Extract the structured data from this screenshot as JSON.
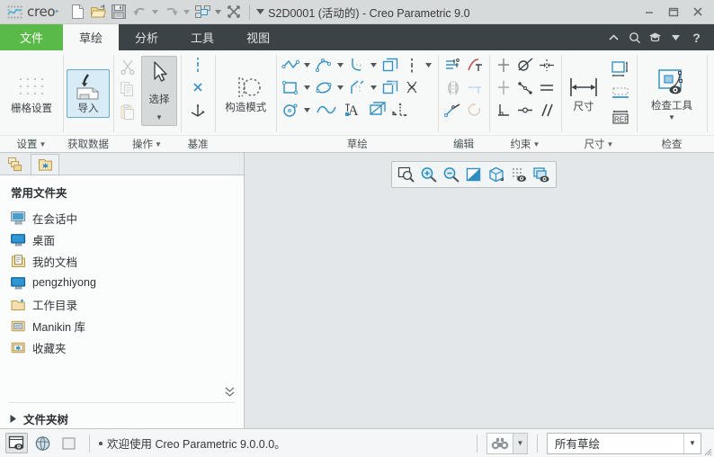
{
  "titlebar": {
    "brand": "creo",
    "window_title": "S2D0001 (活动的) - Creo Parametric 9.0",
    "quick_access": [
      {
        "name": "new-file",
        "label": "新建"
      },
      {
        "name": "open-file",
        "label": "打开"
      },
      {
        "name": "save-file",
        "label": "保存"
      },
      {
        "name": "undo",
        "label": "撤消"
      },
      {
        "name": "redo",
        "label": "重做"
      },
      {
        "name": "window-switch",
        "label": "窗口"
      },
      {
        "name": "close-window",
        "label": "关闭"
      }
    ],
    "window_buttons": [
      "最小化",
      "最大化",
      "关闭"
    ]
  },
  "tabs": [
    {
      "label": "文件",
      "kind": "file"
    },
    {
      "label": "草绘",
      "kind": "active"
    },
    {
      "label": "分析",
      "kind": "normal"
    },
    {
      "label": "工具",
      "kind": "normal"
    },
    {
      "label": "视图",
      "kind": "normal"
    }
  ],
  "tab_right_icons": [
    "chevron-up-icon",
    "search-icon",
    "learning-icon",
    "chevron-down-icon",
    "help-icon"
  ],
  "ribbon": {
    "groups": [
      {
        "label": "设置",
        "has_caret": true,
        "big": {
          "label": "栅格设置",
          "icon": "grid-icon"
        }
      },
      {
        "label": "获取数据",
        "has_caret": false,
        "big": {
          "label": "导入",
          "icon": "import-icon",
          "selected": true
        }
      },
      {
        "label": "操作",
        "has_caret": true,
        "select_label": "选择"
      },
      {
        "label": "基准",
        "has_caret": false
      },
      {
        "label": "草绘",
        "has_caret": false
      },
      {
        "label": "编辑",
        "has_caret": false
      },
      {
        "label": "约束",
        "has_caret": true
      },
      {
        "label": "尺寸",
        "has_caret": true
      },
      {
        "label": "检查",
        "has_caret": false,
        "big": {
          "label": "检查工具",
          "icon": "inspect-icon"
        }
      }
    ],
    "construction_mode": "构造模式"
  },
  "sidebar": {
    "tabs": [
      {
        "name": "model-tree-tab",
        "icon": "layers-icon",
        "active": false
      },
      {
        "name": "favorites-tab",
        "icon": "folder-star-icon",
        "active": true
      }
    ],
    "heading": "常用文件夹",
    "items": [
      {
        "label": "在会话中",
        "icon": "session-icon"
      },
      {
        "label": "桌面",
        "icon": "desktop-icon"
      },
      {
        "label": "我的文档",
        "icon": "documents-icon"
      },
      {
        "label": "pengzhiyong",
        "icon": "user-folder-icon"
      },
      {
        "label": "工作目录",
        "icon": "working-dir-icon"
      },
      {
        "label": "Manikin 库",
        "icon": "library-icon"
      },
      {
        "label": "收藏夹",
        "icon": "favorites-icon"
      }
    ],
    "tree_label": "文件夹树"
  },
  "graphics_toolbar": [
    {
      "name": "zoom-fit-icon",
      "label": "重新调整"
    },
    {
      "name": "zoom-in-icon",
      "label": "放大"
    },
    {
      "name": "zoom-out-icon",
      "label": "缩小"
    },
    {
      "name": "repaint-icon",
      "label": "重画"
    },
    {
      "name": "display-style-icon",
      "label": "显示样式"
    },
    {
      "name": "datum-display-icon",
      "label": "基准显示"
    },
    {
      "name": "annotation-display-icon",
      "label": "注释显示"
    }
  ],
  "statusbar": {
    "left_icons": [
      {
        "name": "model-display-icon",
        "pressed": true
      },
      {
        "name": "globe-icon",
        "pressed": false
      },
      {
        "name": "blank-page-icon",
        "pressed": false
      }
    ],
    "message": "欢迎使用 Creo Parametric 9.0.0.0。",
    "find_label": "查找",
    "filter_value": "所有草绘"
  },
  "colors": {
    "accent_green": "#5aba47",
    "tabbar_dark": "#3b4346",
    "titlebar": "#d6dadb",
    "ribbon_bg": "#f7f9f9",
    "canvas_bg": "#e3e7ea",
    "icon_blue": "#3a92c4",
    "selected_blue": "#d8ecf7"
  }
}
